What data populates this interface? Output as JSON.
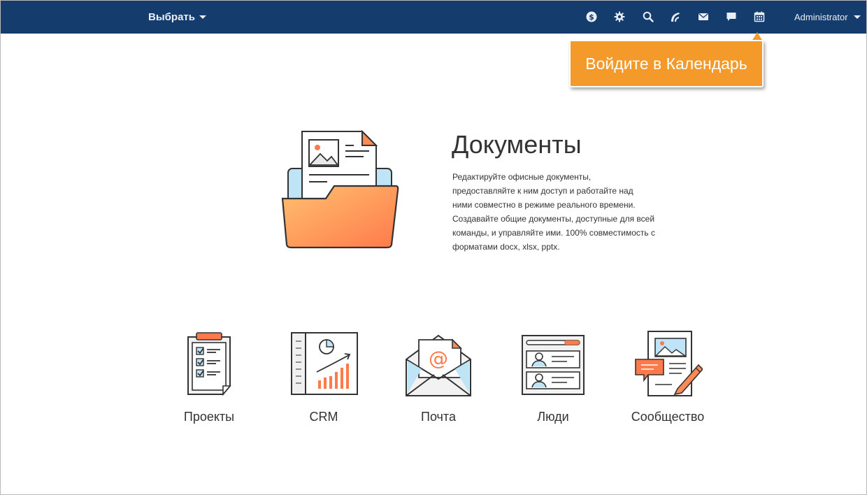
{
  "topbar": {
    "select_label": "Выбрать",
    "user_name": "Administrator",
    "icons": [
      "dollar-icon",
      "gear-icon",
      "search-icon",
      "feed-icon",
      "mail-icon",
      "chat-icon",
      "calendar-icon"
    ],
    "bg_color": "#143d6e"
  },
  "tooltip": {
    "text": "Войдите в Календарь",
    "color": "#f39a2b"
  },
  "hero": {
    "title": "Документы",
    "description": "Редактируйте офисные документы, предоставляйте к ним доступ и работайте над ними совместно в режиме реального времени. Создавайте общие документы, доступные для всей команды, и управляйте ими. 100% совместимость с форматами docx, xlsx, pptx."
  },
  "modules": [
    {
      "label": "Проекты"
    },
    {
      "label": "CRM"
    },
    {
      "label": "Почта"
    },
    {
      "label": "Люди"
    },
    {
      "label": "Сообщество"
    }
  ],
  "accent_color": "#f26f3d"
}
